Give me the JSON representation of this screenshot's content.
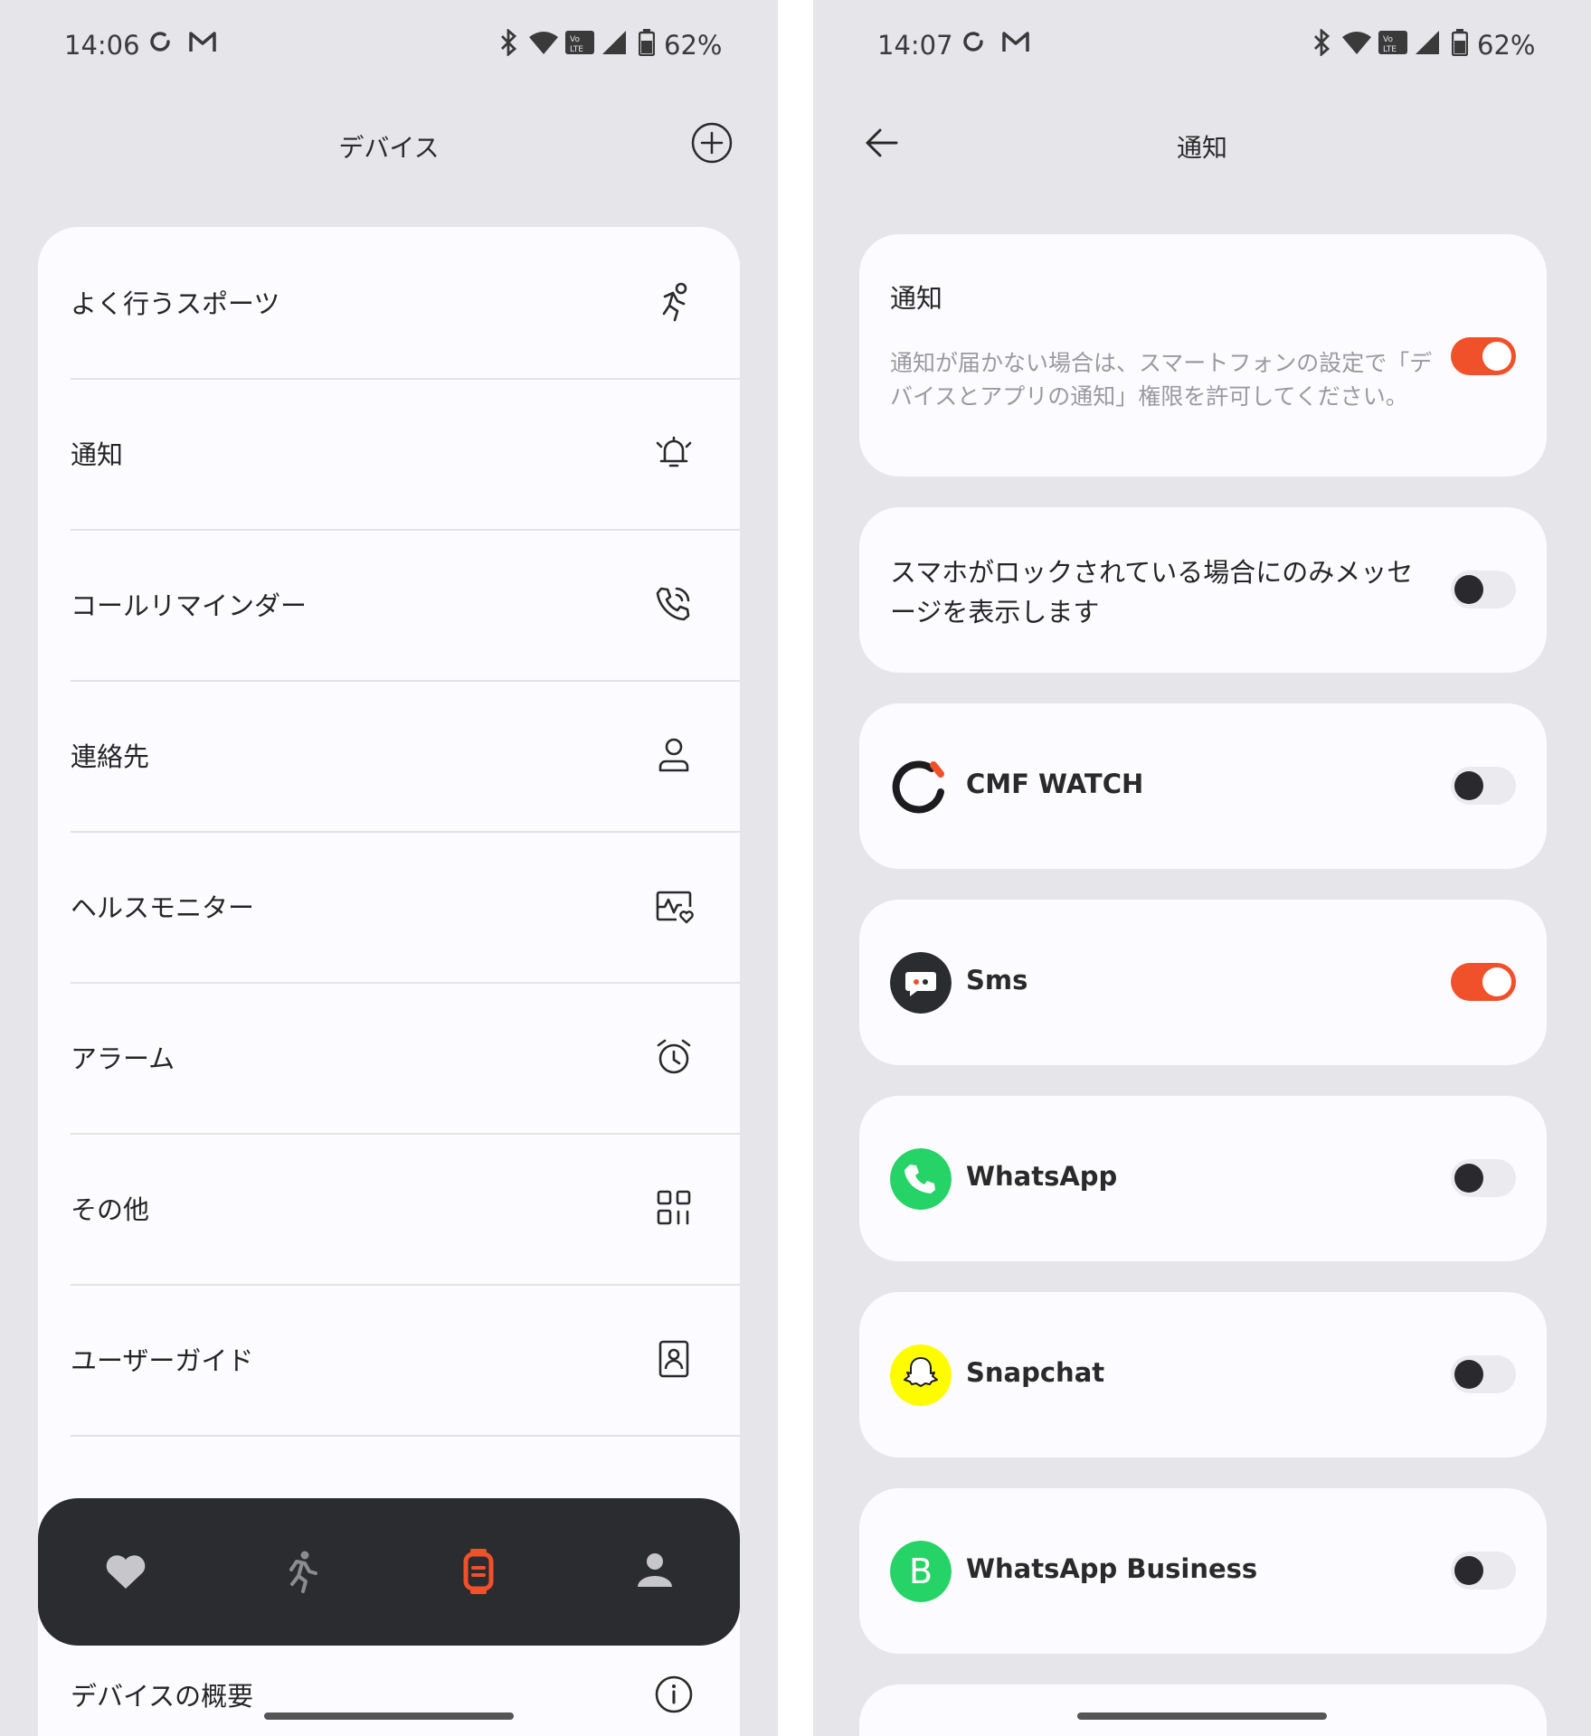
{
  "left": {
    "status": {
      "time": "14:06",
      "battery": "62%"
    },
    "header": {
      "title": "デバイス"
    },
    "menu": [
      {
        "label": "よく行うスポーツ",
        "icon": "running-icon"
      },
      {
        "label": "通知",
        "icon": "bell-icon"
      },
      {
        "label": "コールリマインダー",
        "icon": "phone-call-icon"
      },
      {
        "label": "連絡先",
        "icon": "person-icon"
      },
      {
        "label": "ヘルスモニター",
        "icon": "health-monitor-icon"
      },
      {
        "label": "アラーム",
        "icon": "alarm-icon"
      },
      {
        "label": "その他",
        "icon": "grid-icon"
      },
      {
        "label": "ユーザーガイド",
        "icon": "user-guide-icon"
      },
      {
        "label": "デバイスの概要",
        "icon": "info-icon"
      }
    ],
    "nav": [
      {
        "icon": "heart-icon",
        "active": false
      },
      {
        "icon": "running-icon",
        "active": false
      },
      {
        "icon": "watch-icon",
        "active": true
      },
      {
        "icon": "profile-icon",
        "active": false
      }
    ]
  },
  "right": {
    "status": {
      "time": "14:07",
      "battery": "62%"
    },
    "header": {
      "title": "通知"
    },
    "notification_card": {
      "title": "通知",
      "description": "通知が届かない場合は、スマートフォンの設定で「デバイスとアプリの通知」権限を許可してください。",
      "enabled": true
    },
    "lock_card": {
      "text": "スマホがロックされている場合にのみメッセージを表示します",
      "enabled": false
    },
    "apps": [
      {
        "name": "CMF WATCH",
        "enabled": false,
        "logo": "cmf-watch-logo"
      },
      {
        "name": "Sms",
        "enabled": true,
        "logo": "sms-logo"
      },
      {
        "name": "WhatsApp",
        "enabled": false,
        "logo": "whatsapp-logo"
      },
      {
        "name": "Snapchat",
        "enabled": false,
        "logo": "snapchat-logo"
      },
      {
        "name": "WhatsApp Business",
        "enabled": false,
        "logo": "whatsapp-business-logo",
        "logo_letter": "B"
      }
    ],
    "colors": {
      "accent": "#f0512a",
      "background": "#e6e5ea",
      "card": "#fcfbff"
    }
  }
}
